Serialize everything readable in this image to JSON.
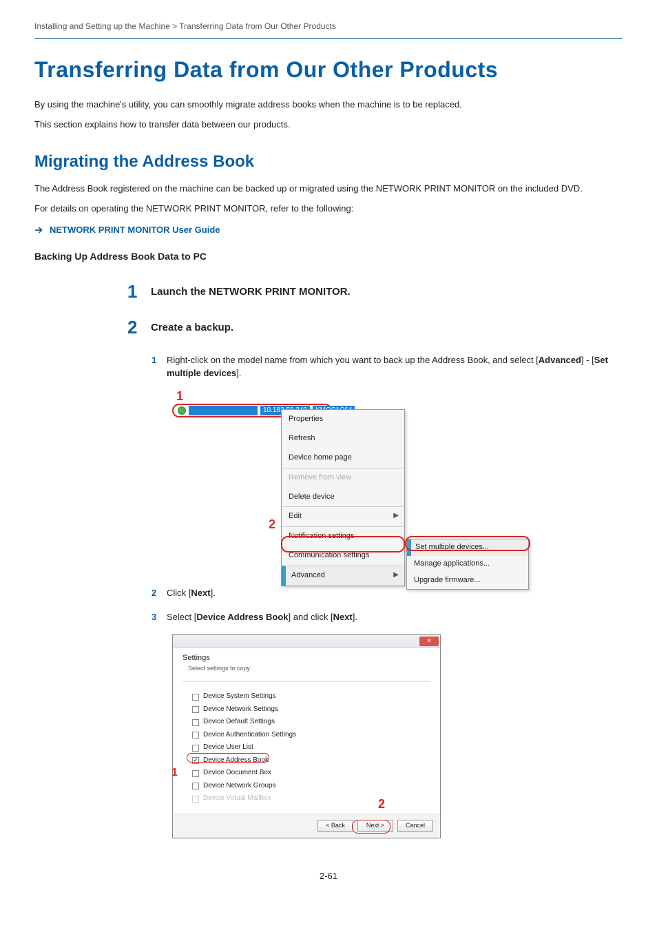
{
  "breadcrumb": "Installing and Setting up the Machine > Transferring Data from Our Other Products",
  "title": "Transferring Data from Our Other Products",
  "intro1": "By using the machine's utility, you can smoothly migrate address books when the machine is to be replaced.",
  "intro2": "This section explains how to transfer data between our products.",
  "section_heading": "Migrating the Address Book",
  "section_p1": "The Address Book registered on the machine can be backed up or migrated using the NETWORK PRINT MONITOR on the included DVD.",
  "section_p2": "For details on operating the NETWORK PRINT MONITOR, refer to the following:",
  "xref": "NETWORK PRINT MONITOR User Guide",
  "subheading": "Backing Up Address Book Data to PC",
  "step1": {
    "num": "1",
    "title": "Launch the NETWORK PRINT MONITOR."
  },
  "step2": {
    "num": "2",
    "title": "Create a backup."
  },
  "sub1": {
    "num": "1",
    "text_pre": "Right-click on the model name from which you want to back up the Address Book, and select [",
    "b1": "Advanced",
    "mid": "] - [",
    "b2": "Set multiple devices",
    "post": "]."
  },
  "sub2": {
    "num": "2",
    "pre": "Click [",
    "b": "Next",
    "post": "]."
  },
  "sub3": {
    "num": "3",
    "pre": "Select [",
    "b1": "Device Address Book",
    "mid": "] and click [",
    "b2": "Next",
    "post": "]."
  },
  "fig1": {
    "callout1": "1",
    "callout2": "2",
    "ip": "10.183.58.249",
    "model": "KMCC1C64",
    "menu": {
      "properties": "Properties",
      "refresh": "Refresh",
      "home": "Device home page",
      "remove": "Remove from view",
      "delete": "Delete device",
      "edit": "Edit",
      "notif": "Notification settings",
      "comm": "Communication settings",
      "advanced": "Advanced"
    },
    "submenu": {
      "set_multi": "Set multiple devices...",
      "manage_apps": "Manage applications...",
      "upgrade_fw": "Upgrade firmware..."
    }
  },
  "fig2": {
    "close": "✕",
    "hdr_title": "Settings",
    "hdr_sub": "Select settings to copy",
    "items": {
      "sys": "Device System Settings",
      "net": "Device Network Settings",
      "def": "Device Default Settings",
      "auth": "Device Authentication Settings",
      "user": "Device User List",
      "addr": "Device Address Book",
      "doc": "Device Document Box",
      "grp": "Device Network Groups",
      "vm": "Device Virtual Mailbox"
    },
    "callout1": "1",
    "callout2": "2",
    "btn_back": "< Back",
    "btn_next": "Next >",
    "btn_cancel": "Cancel"
  },
  "page_footer": "2-61"
}
